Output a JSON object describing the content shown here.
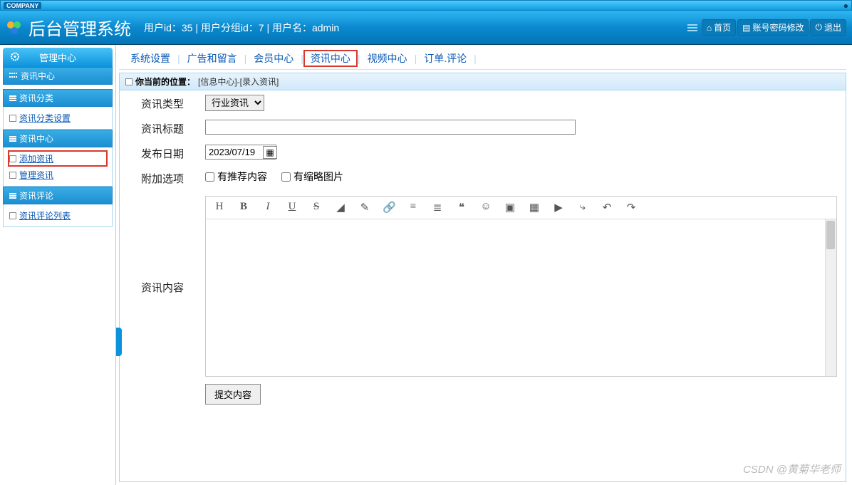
{
  "company_badge": "COMPANY",
  "app_title": "后台管理系统",
  "userinfo": "用户id：35 | 用户分组id：7 | 用户名：admin",
  "header_buttons": {
    "home": "首页",
    "password": "账号密码修改",
    "logout": "退出"
  },
  "sidebar": {
    "top_tab": "管理中心",
    "section1_title": "资讯中心",
    "cat_title": "资讯分类",
    "cat_item": "资讯分类设置",
    "center_title": "资讯中心",
    "add_item": "添加资讯",
    "manage_item": "管理资讯",
    "review_title": "资讯评论",
    "review_item": "资讯评论列表"
  },
  "topnav": {
    "system": "系统设置",
    "ads": "广告和留言",
    "member": "会员中心",
    "news": "资讯中心",
    "video": "视频中心",
    "order": "订单.评论"
  },
  "breadcrumb": {
    "label": "你当前的位置：",
    "path": "[信息中心]-[录入资讯]"
  },
  "form": {
    "type_label": "资讯类型",
    "type_option": "行业资讯",
    "title_label": "资讯标题",
    "title_value": "",
    "date_label": "发布日期",
    "date_value": "2023/07/19",
    "extra_label": "附加选项",
    "chk_recommend": "有推荐内容",
    "chk_thumb": "有缩略图片",
    "content_label": "资讯内容",
    "submit": "提交内容"
  },
  "watermark": "CSDN @黄菊华老师"
}
